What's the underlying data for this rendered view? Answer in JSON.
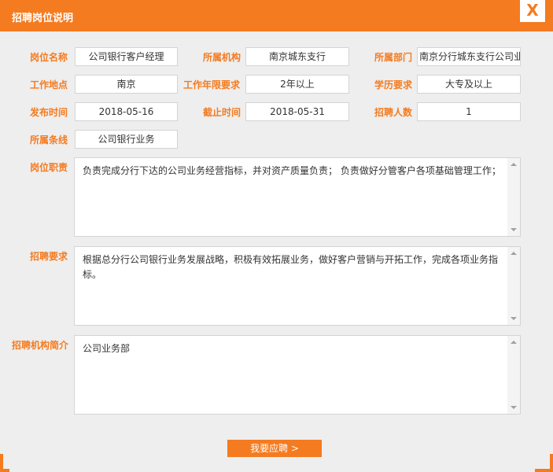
{
  "dialog": {
    "title": "招聘岗位说明",
    "close_label": "X"
  },
  "fields": {
    "position_name": {
      "label": "岗位名称",
      "value": "公司银行客户经理"
    },
    "institution": {
      "label": "所属机构",
      "value": "南京城东支行"
    },
    "department": {
      "label": "所属部门",
      "value": "南京分行城东支行公司业务部"
    },
    "work_location": {
      "label": "工作地点",
      "value": "南京"
    },
    "work_years": {
      "label": "工作年限要求",
      "value": "2年以上"
    },
    "education": {
      "label": "学历要求",
      "value": "大专及以上"
    },
    "publish_date": {
      "label": "发布时间",
      "value": "2018-05-16"
    },
    "deadline": {
      "label": "截止时间",
      "value": "2018-05-31"
    },
    "headcount": {
      "label": "招聘人数",
      "value": "1"
    },
    "business_line": {
      "label": "所属条线",
      "value": "公司银行业务"
    }
  },
  "duties": {
    "label": "岗位职责",
    "text": "负责完成分行下达的公司业务经营指标，并对资产质量负责； 负责做好分管客户各项基础管理工作；"
  },
  "requirements": {
    "label": "招聘要求",
    "text": "根据总分行公司银行业务发展战略，积极有效拓展业务，做好客户营销与开拓工作，完成各项业务指标。"
  },
  "org_intro": {
    "label": "招聘机构简介",
    "text": "公司业务部"
  },
  "apply_button": {
    "label": "我要应聘 >"
  },
  "colors": {
    "accent": "#f47b20",
    "background": "#eeeeee",
    "border": "#d4d4d4"
  }
}
